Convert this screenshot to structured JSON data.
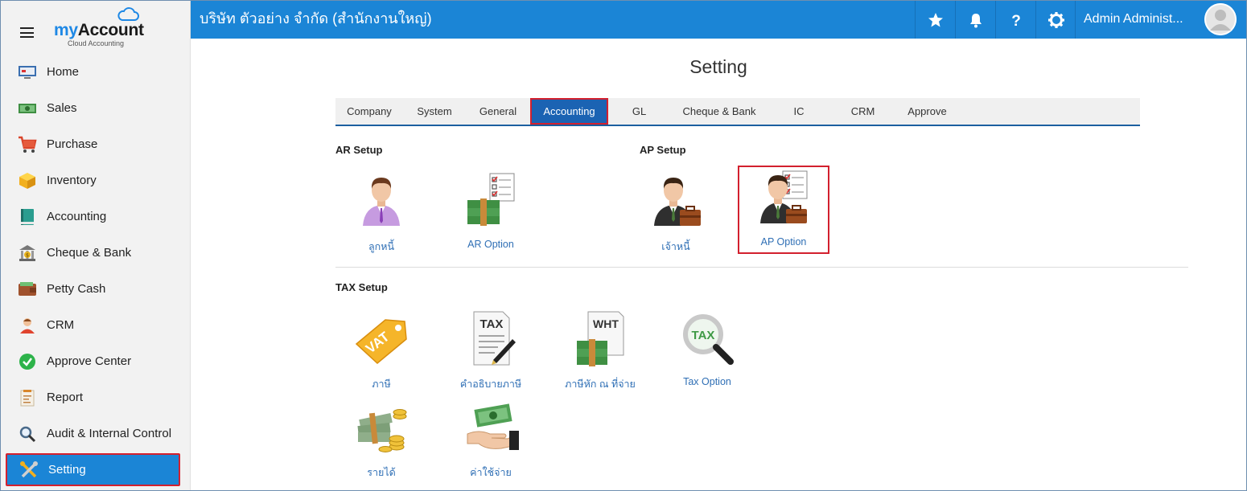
{
  "brand": {
    "name_part1": "my",
    "name_part2": "Account",
    "tagline": "Cloud Accounting"
  },
  "sidebar": {
    "items": [
      {
        "label": "Home",
        "icon": "monitor-icon"
      },
      {
        "label": "Sales",
        "icon": "cash-icon"
      },
      {
        "label": "Purchase",
        "icon": "cart-icon"
      },
      {
        "label": "Inventory",
        "icon": "box-icon"
      },
      {
        "label": "Accounting",
        "icon": "ledger-book-icon"
      },
      {
        "label": "Cheque & Bank",
        "icon": "bank-icon"
      },
      {
        "label": "Petty Cash",
        "icon": "wallet-icon"
      },
      {
        "label": "CRM",
        "icon": "people-icon"
      },
      {
        "label": "Approve Center",
        "icon": "check-circle-icon"
      },
      {
        "label": "Report",
        "icon": "report-icon"
      },
      {
        "label": "Audit & Internal Control",
        "icon": "magnifier-icon"
      },
      {
        "label": "Setting",
        "icon": "tools-icon",
        "active": true
      }
    ]
  },
  "topbar": {
    "company": "บริษัท ตัวอย่าง จำกัด (สำนักงานใหญ่)",
    "user_name": "Admin Administ...",
    "icons": [
      "star-icon",
      "bell-icon",
      "help-icon",
      "gear-icon"
    ]
  },
  "main": {
    "title": "Setting",
    "tabs": [
      {
        "label": "Company"
      },
      {
        "label": "System"
      },
      {
        "label": "General"
      },
      {
        "label": "Accounting",
        "active": true
      },
      {
        "label": "GL"
      },
      {
        "label": "Cheque & Bank"
      },
      {
        "label": "IC"
      },
      {
        "label": "CRM"
      },
      {
        "label": "Approve"
      }
    ],
    "ar_setup": {
      "title": "AR Setup",
      "items": [
        {
          "label": "ลูกหนี้",
          "icon": "customer-person-icon"
        },
        {
          "label": "AR Option",
          "icon": "money-checklist-icon"
        }
      ]
    },
    "ap_setup": {
      "title": "AP Setup",
      "items": [
        {
          "label": "เจ้าหนี้",
          "icon": "businessman-briefcase-icon"
        },
        {
          "label": "AP Option",
          "icon": "businessman-checklist-icon",
          "selected": true
        }
      ]
    },
    "tax_setup": {
      "title": "TAX Setup",
      "items": [
        {
          "label": "ภาษี",
          "icon": "vat-tag-icon",
          "tag_text": "VAT"
        },
        {
          "label": "คำอธิบายภาษี",
          "icon": "tax-document-pen-icon",
          "tag_text": "TAX"
        },
        {
          "label": "ภาษีหัก ณ ที่จ่าย",
          "icon": "wht-document-money-icon",
          "tag_text": "WHT"
        },
        {
          "label": "Tax Option",
          "icon": "tax-magnifier-icon",
          "tag_text": "TAX"
        },
        {
          "label": "รายได้",
          "icon": "money-coins-icon"
        },
        {
          "label": "ค่าใช้จ่าย",
          "icon": "hand-money-icon"
        }
      ]
    }
  },
  "colors": {
    "primary": "#1b85d6",
    "highlight_border": "#d3202e",
    "link": "#2f6fb5",
    "sidebar_bg": "#f2f2f2"
  }
}
